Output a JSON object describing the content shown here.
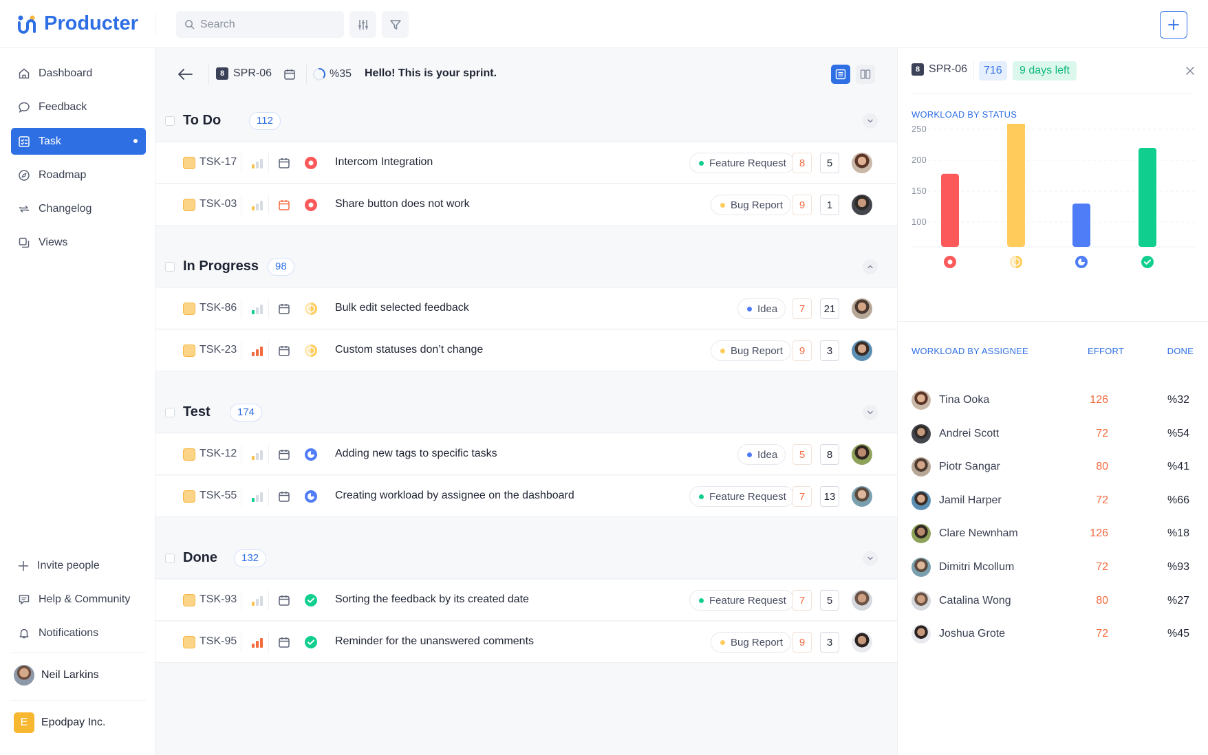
{
  "app": {
    "name": "Producter"
  },
  "search": {
    "placeholder": "Search"
  },
  "sidebar": {
    "items": [
      {
        "label": "Dashboard"
      },
      {
        "label": "Feedback"
      },
      {
        "label": "Task"
      },
      {
        "label": "Roadmap"
      },
      {
        "label": "Changelog"
      },
      {
        "label": "Views"
      }
    ],
    "bottom": [
      {
        "label": "Invite people"
      },
      {
        "label": "Help & Community"
      },
      {
        "label": "Notifications"
      }
    ],
    "user": {
      "name": "Neil Larkins"
    },
    "workspace": {
      "initial": "E",
      "name": "Epodpay Inc."
    }
  },
  "header": {
    "sprint_badge": "8",
    "sprint_id": "SPR-06",
    "progress": "%35",
    "progress_fraction": 0.35,
    "greeting": "Hello! This is your sprint."
  },
  "groups": [
    {
      "title": "To Do",
      "count": "112",
      "tasks": [
        {
          "id": "TSK-17",
          "title": "Intercom Integration",
          "tag": "Feature Request",
          "effort": "8",
          "done": "5"
        },
        {
          "id": "TSK-03",
          "title": "Share button does not work",
          "tag": "Bug Report",
          "effort": "9",
          "done": "1"
        }
      ]
    },
    {
      "title": "In Progress",
      "count": "98",
      "tasks": [
        {
          "id": "TSK-86",
          "title": "Bulk edit selected feedback",
          "tag": "Idea",
          "effort": "7",
          "done": "21"
        },
        {
          "id": "TSK-23",
          "title": "Custom statuses don’t change",
          "tag": "Bug Report",
          "effort": "9",
          "done": "3"
        }
      ]
    },
    {
      "title": "Test",
      "count": "174",
      "tasks": [
        {
          "id": "TSK-12",
          "title": "Adding new tags to specific tasks",
          "tag": "Idea",
          "effort": "5",
          "done": "8"
        },
        {
          "id": "TSK-55",
          "title": "Creating workload by assignee on the dashboard",
          "tag": "Feature Request",
          "effort": "7",
          "done": "13"
        }
      ]
    },
    {
      "title": "Done",
      "count": "132",
      "tasks": [
        {
          "id": "TSK-93",
          "title": "Sorting the feedback by its created date",
          "tag": "Feature Request",
          "effort": "7",
          "done": "5"
        },
        {
          "id": "TSK-95",
          "title": "Reminder for the unanswered comments",
          "tag": "Bug Report",
          "effort": "9",
          "done": "3"
        }
      ]
    }
  ],
  "panel": {
    "sprint_badge": "8",
    "sprint_id": "SPR-06",
    "total": "716",
    "days_left": "9 days left",
    "status_title": "WORKLOAD BY STATUS",
    "assignee_title": "WORKLOAD BY ASSIGNEE",
    "effort_header": "EFFORT",
    "done_header": "DONE",
    "assignees": [
      {
        "name": "Tina Ooka",
        "effort": "126",
        "done": "%32"
      },
      {
        "name": "Andrei Scott",
        "effort": "72",
        "done": "%54"
      },
      {
        "name": "Piotr Sangar",
        "effort": "80",
        "done": "%41"
      },
      {
        "name": "Jamil Harper",
        "effort": "72",
        "done": "%66"
      },
      {
        "name": "Clare Newnham",
        "effort": "126",
        "done": "%18"
      },
      {
        "name": "Dimitri Mcollum",
        "effort": "72",
        "done": "%93"
      },
      {
        "name": "Catalina Wong",
        "effort": "80",
        "done": "%27"
      },
      {
        "name": "Joshua Grote",
        "effort": "72",
        "done": "%45"
      }
    ]
  },
  "colors": {
    "accent": "#2f6fe4",
    "todo": "#fc5a5a",
    "in_progress": "#ffcc5c",
    "test": "#4f7cf7",
    "done": "#10cf8e",
    "effort": "#f26a3d"
  },
  "chart_data": {
    "type": "bar",
    "title": "WORKLOAD BY STATUS",
    "categories": [
      "To Do",
      "In Progress",
      "Test",
      "Done"
    ],
    "values": [
      178,
      262,
      130,
      220
    ],
    "yticks": [
      100,
      150,
      200,
      250
    ],
    "ylim": [
      60,
      250
    ],
    "grid": true,
    "legend": "none"
  }
}
